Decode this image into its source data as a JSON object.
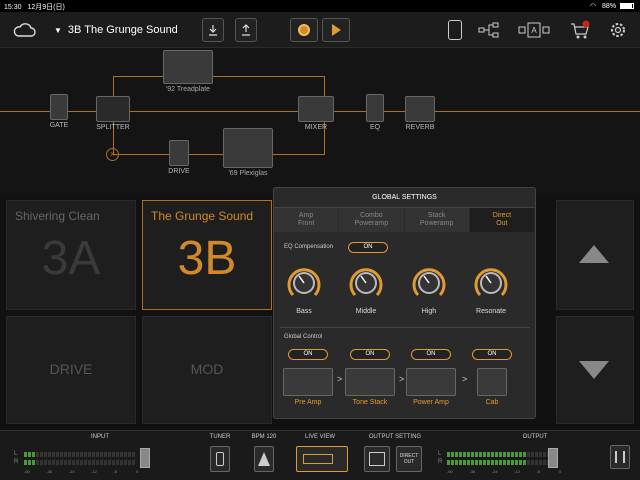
{
  "status": {
    "time": "15:30",
    "date": "12月9日(日)",
    "battery": "88%"
  },
  "topbar": {
    "preset_name": "3B The Grunge Sound"
  },
  "chain": {
    "gate": "GATE",
    "splitter": "SPLITTER",
    "amp_top": "'92 Treadplate",
    "mixer": "MIXER",
    "eq": "EQ",
    "reverb": "REVERB",
    "drive": "DRIVE",
    "amp_bottom": "'69 Plexiglas"
  },
  "presets": [
    {
      "title": "Shivering Clean",
      "big": "3A"
    },
    {
      "title": "The Grunge Sound",
      "big": "3B"
    },
    {
      "title": "",
      "big": "DRIVE"
    },
    {
      "title": "",
      "big": "MOD"
    }
  ],
  "global_settings": {
    "title": "GLOBAL SETTINGS",
    "tabs": [
      {
        "l1": "Amp",
        "l2": "Front"
      },
      {
        "l1": "Combo",
        "l2": "Poweramp"
      },
      {
        "l1": "Stack",
        "l2": "Poweramp"
      },
      {
        "l1": "Direct",
        "l2": "Out"
      }
    ],
    "eq_comp_label": "EQ Compensation",
    "eq_comp_state": "ON",
    "knobs": [
      {
        "label": "Bass",
        "value": 0.5
      },
      {
        "label": "Middle",
        "value": 0.5
      },
      {
        "label": "High",
        "value": 0.5
      },
      {
        "label": "Resonate",
        "value": 0.5
      }
    ],
    "global_control_label": "Global Control",
    "blocks": [
      {
        "label": "Pre Amp",
        "state": "ON"
      },
      {
        "label": "Tone Stack",
        "state": "ON"
      },
      {
        "label": "Power Amp",
        "state": "ON"
      },
      {
        "label": "Cab",
        "state": "ON"
      }
    ],
    "sep": ">"
  },
  "bottom": {
    "input": "INPUT",
    "tuner": "TUNER",
    "bpm": "BPM 120",
    "live_view": "LIVE VIEW",
    "output_setting": "OUTPUT SETTING",
    "direct_out": "DIRECT OUT",
    "output": "OUTPUT",
    "ch_l": "L",
    "ch_r": "R",
    "scale": [
      "-60",
      "-36",
      "-24",
      "-12",
      "-6",
      "0"
    ],
    "input_level": 0.1,
    "output_level": 0.7
  },
  "colors": {
    "accent": "#e09a30",
    "meter": "#4a9a3a"
  }
}
